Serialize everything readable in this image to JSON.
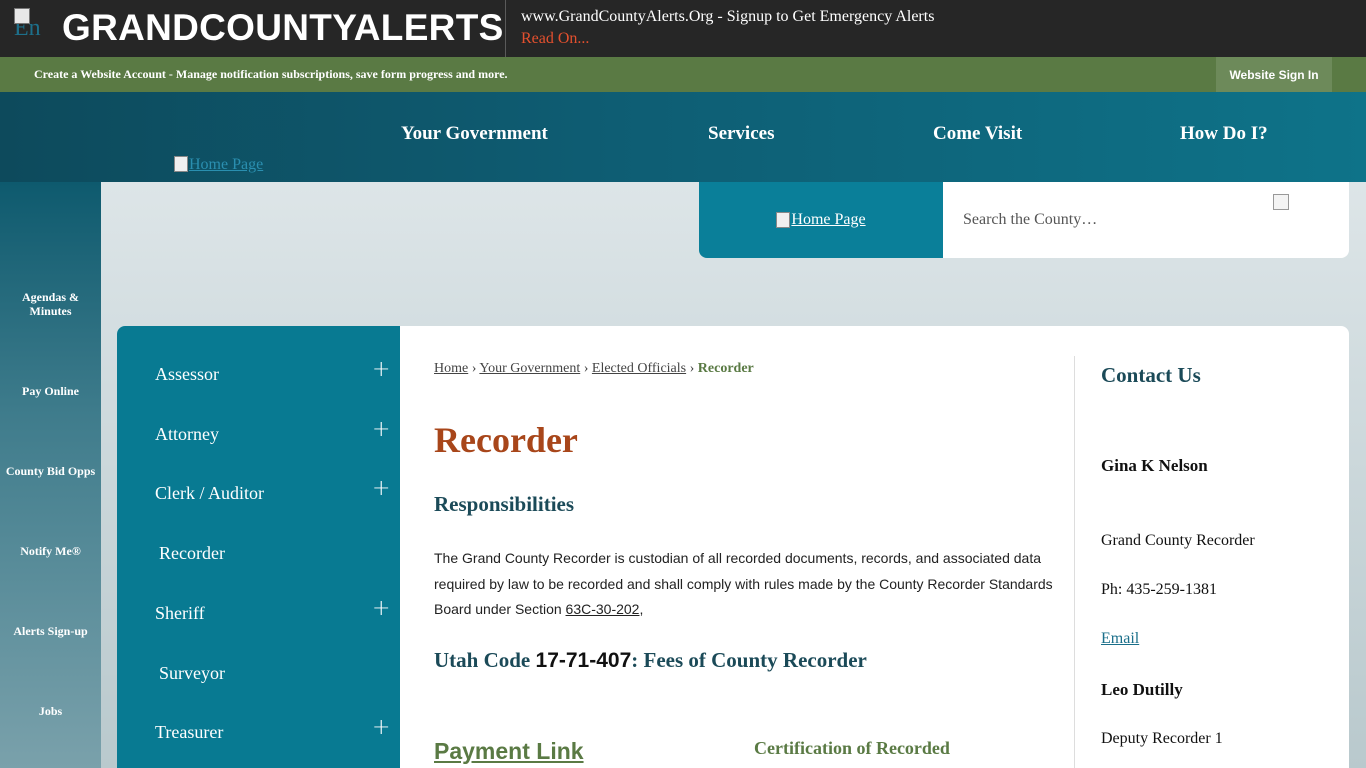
{
  "alert_bar": {
    "logo_alt": "En",
    "logo_text": "GRANDCOUNTYALERTS",
    "message": "www.GrandCountyAlerts.Org - Signup to Get Emergency Alerts",
    "read_on": "Read On..."
  },
  "account_bar": {
    "text": "Create a Website Account - Manage notification subscriptions, save form progress and more.",
    "sign_in": "Website Sign In"
  },
  "nav": {
    "home_link": "Home Page",
    "items": [
      "Your Government",
      "Services",
      "Come Visit",
      "How Do I?"
    ]
  },
  "header": {
    "logo_link": "Home Page",
    "search_placeholder": "Search the County…"
  },
  "quick_links": [
    "Agendas & Minutes",
    "Pay Online",
    "County Bid Opps",
    "Notify Me®",
    "Alerts Sign-up",
    "Jobs"
  ],
  "subnav": [
    {
      "label": "Assessor",
      "expandable": true
    },
    {
      "label": "Attorney",
      "expandable": true
    },
    {
      "label": "Clerk / Auditor",
      "expandable": true
    },
    {
      "label": "Recorder",
      "expandable": false
    },
    {
      "label": "Sheriff",
      "expandable": true
    },
    {
      "label": "Surveyor",
      "expandable": false
    },
    {
      "label": "Treasurer",
      "expandable": true
    }
  ],
  "breadcrumb": {
    "items": [
      "Home",
      "Your Government",
      "Elected Officials"
    ],
    "current": "Recorder",
    "separator": "›"
  },
  "content": {
    "title": "Recorder",
    "responsibilities_heading": "Responsibilities",
    "body_prefix": "The Grand County Recorder is custodian of all recorded documents, records, and associated data required by law to be recorded and shall comply with rules made by the County Recorder Standards Board under Section ",
    "body_link": "63C-30-202",
    "body_suffix": ",",
    "utah_prefix": "Utah Code ",
    "utah_code": "17-71-407",
    "utah_suffix": ": Fees of County Recorder",
    "payment_link": "Payment Link",
    "cert_heading": "Certification of Recorded"
  },
  "contact": {
    "title": "Contact Us",
    "person1_name": "Gina K Nelson",
    "person1_title": "Grand County Recorder",
    "phone": "Ph: 435-259-1381",
    "email": "Email",
    "person2_name": "Leo Dutilly",
    "person2_title": "Deputy Recorder 1"
  },
  "colors": {
    "alert_bg": "#262626",
    "account_bar": "#5a7a44",
    "nav": "#0e5d73",
    "subnav": "#087a92",
    "title": "#a8461a",
    "heading": "#1b4a58"
  }
}
